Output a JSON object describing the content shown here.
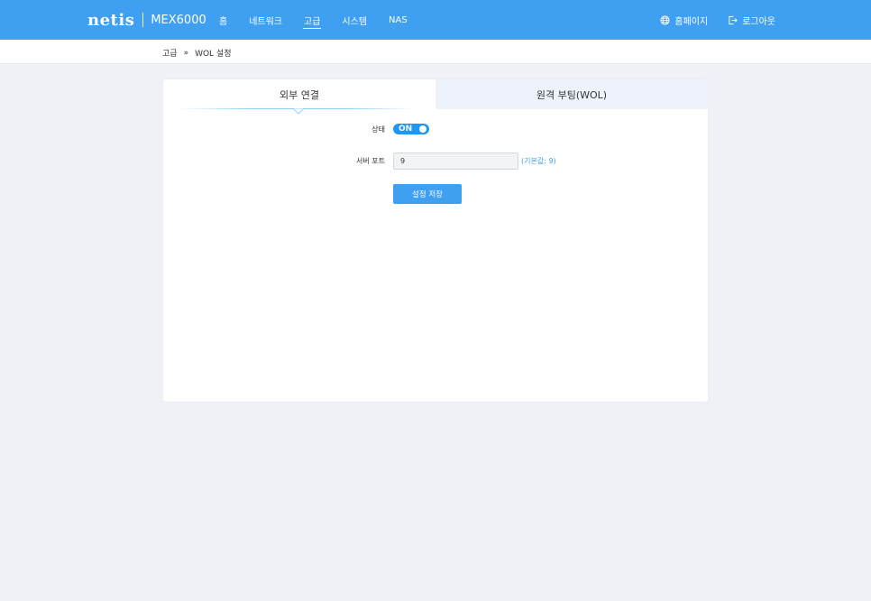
{
  "header": {
    "brand": "netis",
    "model": "MEX6000",
    "nav": [
      "홈",
      "네트워크",
      "고급",
      "시스템",
      "NAS"
    ],
    "homepage_label": "홈페이지",
    "logout_label": "로그아웃"
  },
  "breadcrumb": {
    "parent": "고급",
    "separator": "»",
    "current": "WOL 설정"
  },
  "tabs": {
    "external": "외부 연결",
    "remote_boot": "원격 부팅(WOL)"
  },
  "form": {
    "status_label": "상태",
    "status_value": "ON",
    "port_label": "서버 포트",
    "port_value": "9",
    "port_hint": "(기본값: 9)",
    "save_label": "설정 저장"
  },
  "colors": {
    "accent": "#3fa0f2",
    "toggle": "#2196f3"
  }
}
